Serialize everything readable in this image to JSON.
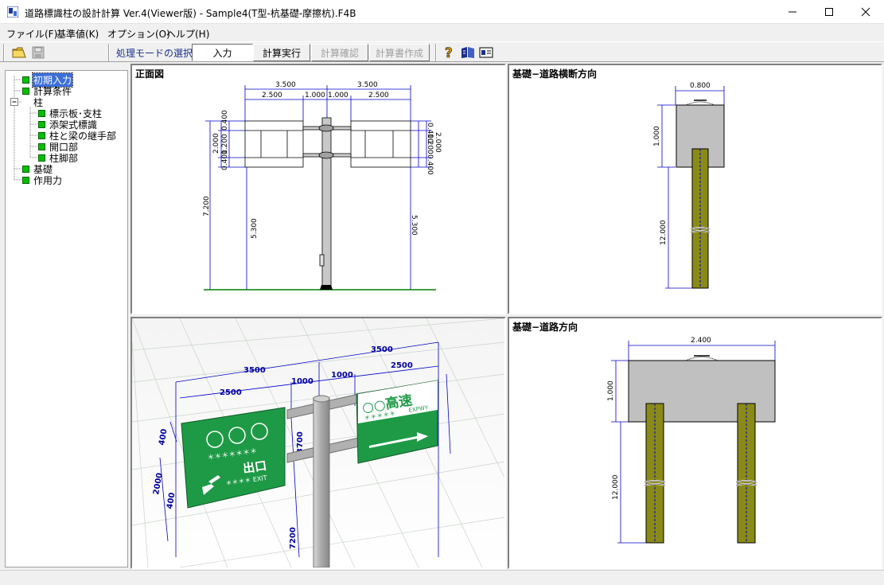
{
  "window": {
    "title": "道路標識柱の設計計算 Ver.4(Viewer版) - Sample4(T型-杭基礎-摩擦杭).F4B"
  },
  "menu": [
    {
      "label": "ファイル(F)"
    },
    {
      "label": "基準値(K)"
    },
    {
      "label": "オプション(O)"
    },
    {
      "label": "ヘルプ(H)"
    }
  ],
  "toolbar": {
    "mode_label": "処理モードの選択",
    "buttons": [
      {
        "label": "入力",
        "state": "active"
      },
      {
        "label": "計算実行",
        "state": "enabled"
      },
      {
        "label": "計算確認",
        "state": "disabled"
      },
      {
        "label": "計算書作成",
        "state": "disabled"
      }
    ],
    "icons": [
      "open-folder-icon",
      "save-icon",
      "help-icon",
      "manual-book-icon",
      "info-card-icon"
    ]
  },
  "tree": [
    {
      "label": "初期入力",
      "level": 0,
      "selected": true
    },
    {
      "label": "計算条件",
      "level": 0
    },
    {
      "label": "柱",
      "level": 0,
      "expandable": true,
      "expanded": true
    },
    {
      "label": "標示板･支柱",
      "level": 1
    },
    {
      "label": "添架式標識",
      "level": 1
    },
    {
      "label": "柱と梁の継手部",
      "level": 1
    },
    {
      "label": "開口部",
      "level": 1
    },
    {
      "label": "柱脚部",
      "level": 1
    },
    {
      "label": "基礎",
      "level": 0
    },
    {
      "label": "作用力",
      "level": 0
    }
  ],
  "panels": {
    "front": {
      "title": "正面図",
      "dims": {
        "left_span": "3.500",
        "right_span": "3.500",
        "left_board": "2.500",
        "left_arm": "1.000",
        "right_arm": "1.000",
        "right_board": "2.500",
        "left_board_height": "2.000",
        "left_top": "0.400",
        "left_mid": "1.200",
        "left_bottom": "0.400",
        "right_board_height": "2.000",
        "right_top": "0.400",
        "right_mid": "1.200",
        "right_bottom": "0.400",
        "left_total_height": "7.200",
        "left_clear_height": "5.300",
        "right_clear_height": "5.300"
      }
    },
    "cross": {
      "title": "基礎−道路横断方向",
      "dims": {
        "width": "0.800",
        "footing_height": "1.000",
        "pile_length": "12.000"
      }
    },
    "view3d": {
      "dims": [
        "3500",
        "3500",
        "1000",
        "1000",
        "2500",
        "2500",
        "2000",
        "400",
        "400",
        "7200",
        "3700"
      ],
      "left_sign": {
        "circles": "○○○",
        "stars": "＊＊＊＊＊＊＊",
        "exit": "出口",
        "exit_en": "＊＊＊＊ EXIT"
      },
      "right_sign": {
        "heading": "○○高速",
        "stars": "＊＊＊＊＊",
        "sub": "EXPWY"
      },
      "colors": {
        "sign_green": "#1e9a46",
        "pole_gray": "#b8b8b8",
        "dim_blue": "#0000c8"
      }
    },
    "road": {
      "title": "基礎−道路方向",
      "dims": {
        "width": "2.400",
        "footing_height": "1.000",
        "pile_length": "12.000"
      }
    }
  },
  "colors": {
    "pile_olive": "#8a8a18",
    "footing_gray": "#c0c0c0",
    "dim_blue": "#0000c8"
  }
}
